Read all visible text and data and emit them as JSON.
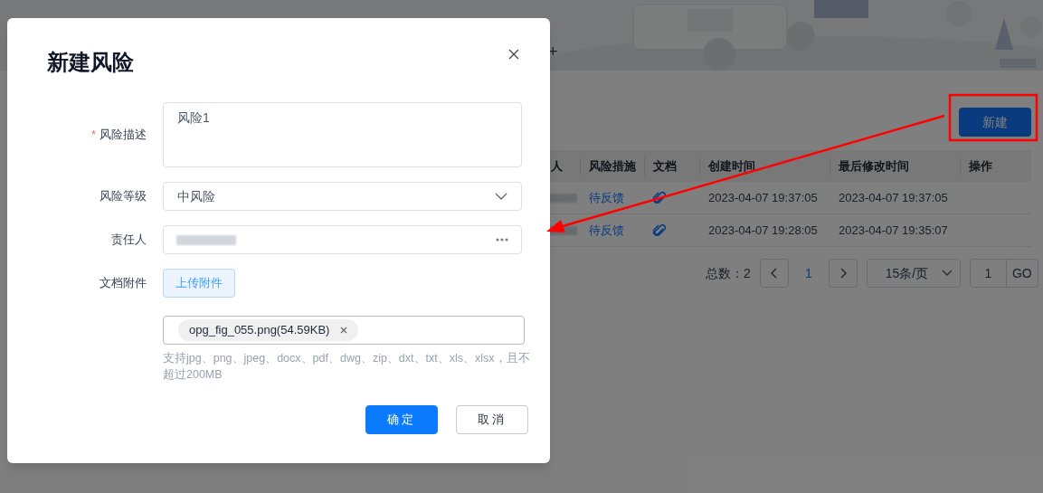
{
  "background": {
    "tab_add": "+",
    "new_button": "新建",
    "table": {
      "columns": [
        "人",
        "风险措施",
        "文档",
        "创建时间",
        "最后修改时间",
        "操作"
      ],
      "rows": [
        {
          "measure": "待反馈",
          "has_document": true,
          "created": "2023-04-07 19:37:05",
          "modified": "2023-04-07 19:37:05"
        },
        {
          "measure": "待反馈",
          "has_document": true,
          "created": "2023-04-07 19:28:05",
          "modified": "2023-04-07 19:35:07"
        }
      ]
    },
    "pagination": {
      "total_label": "总数：",
      "total": "2",
      "pages": [
        {
          "label": "1",
          "selected": true
        }
      ],
      "page_size": "15条/页",
      "jump_value": "1",
      "go": "GO"
    }
  },
  "dialog": {
    "title": "新建风险",
    "fields": [
      {
        "kind": "textarea",
        "label": "风险描述",
        "required_mark": "*",
        "value": "风险1"
      },
      {
        "kind": "select",
        "label": "风险等级",
        "value": "中风险"
      },
      {
        "kind": "picker",
        "label": "责任人"
      },
      {
        "kind": "upload",
        "label": "文档附件",
        "button": "上传附件",
        "files": [
          "opg_fig_055.png(54.59KB)"
        ],
        "hint": "支持jpg、png、jpeg、docx、pdf、dwg、zip、dxt、txt、xls、xlsx，且不超过200MB"
      }
    ],
    "buttons": [
      {
        "label": "确定",
        "kind": "primary"
      },
      {
        "label": "取消",
        "kind": "default"
      }
    ]
  }
}
